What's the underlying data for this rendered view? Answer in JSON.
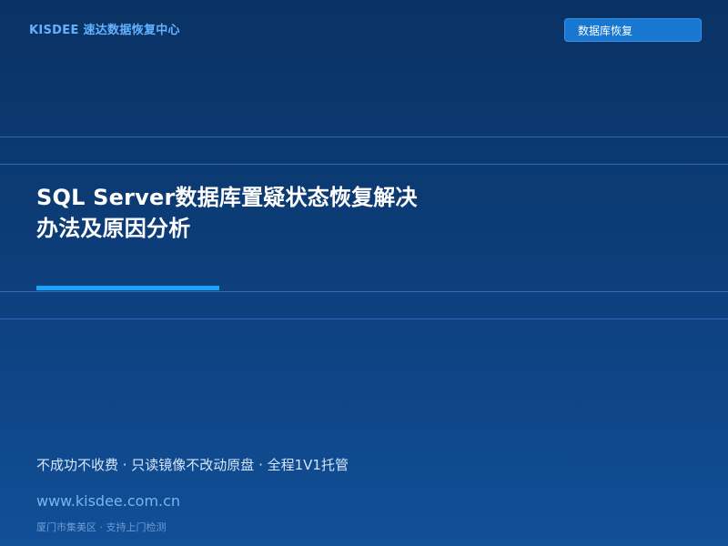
{
  "header": {
    "brand": "KISDEE 速达数据恢复中心",
    "tag_button": "数据库恢复"
  },
  "hero": {
    "title": "SQL Server数据库置疑状态恢复解决办法及原因分析"
  },
  "footer": {
    "tagline": "不成功不收费 · 只读镜像不改动原盘 · 全程1V1托管",
    "url": "www.kisdee.com.cn",
    "location": "厦门市集美区 · 支持上门检测"
  },
  "colors": {
    "background_top": "#0a3264",
    "background_bottom": "#114f97",
    "brand_text": "#63b2ff",
    "button": "#1777d1",
    "accent": "#15a5ff"
  }
}
